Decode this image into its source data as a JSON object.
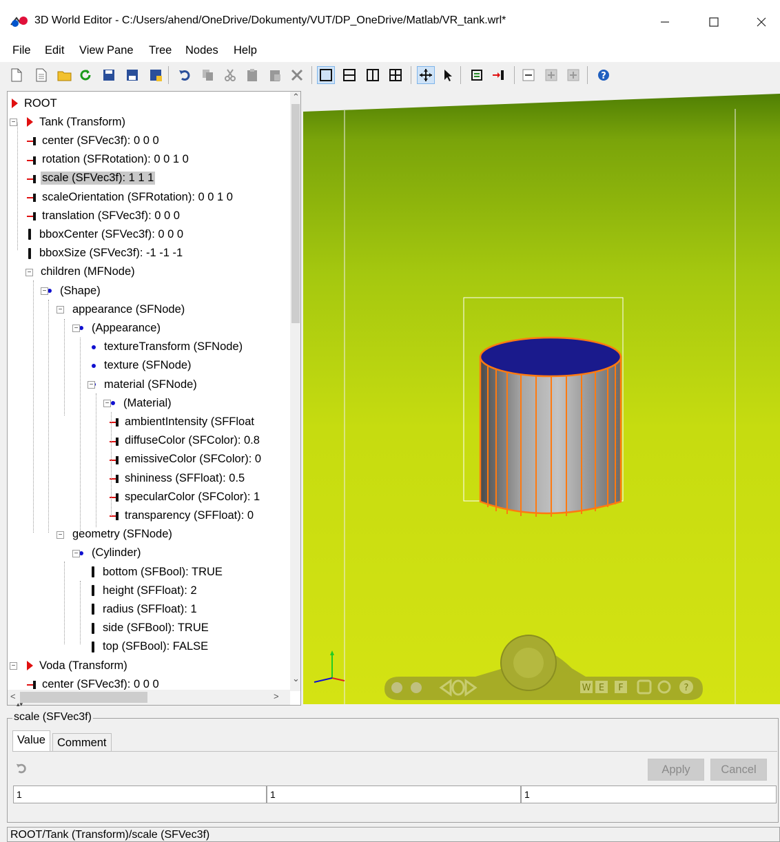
{
  "window": {
    "title": "3D World Editor - C:/Users/ahend/OneDrive/Dokumenty/VUT/DP_OneDrive/Matlab/VR_tank.wrl*"
  },
  "menu": [
    "File",
    "Edit",
    "View Pane",
    "Tree",
    "Nodes",
    "Help"
  ],
  "toolbar": {
    "icons": [
      "new-document-icon",
      "new-from-template-icon",
      "open-folder-icon",
      "reload-icon",
      "save-icon",
      "save-as-icon",
      "save-copy-icon",
      "undo-icon",
      "copy-icon",
      "cut-icon",
      "paste-icon",
      "paste-special-icon",
      "delete-icon",
      "single-view-icon",
      "split-horizontal-icon",
      "split-vertical-icon",
      "quad-view-icon",
      "move-icon",
      "select-arrow-icon",
      "inline-node-icon",
      "insert-field-icon",
      "collapse-icon",
      "expand-icon",
      "expand-all-icon",
      "help-icon"
    ]
  },
  "tree": [
    {
      "label": "ROOT",
      "icon": "tri"
    },
    {
      "label": "Tank (Transform)",
      "icon": "tri"
    },
    {
      "label": "center (SFVec3f): 0  0  0",
      "icon": "field"
    },
    {
      "label": "rotation (SFRotation): 0  0  1  0",
      "icon": "field"
    },
    {
      "label": "scale (SFVec3f): 1  1  1",
      "icon": "field"
    },
    {
      "label": "scaleOrientation (SFRotation): 0  0  1  0",
      "icon": "field"
    },
    {
      "label": "translation (SFVec3f): 0  0  0",
      "icon": "field"
    },
    {
      "label": "bboxCenter (SFVec3f): 0  0  0",
      "icon": "bar"
    },
    {
      "label": "bboxSize (SFVec3f): -1 -1 -1",
      "icon": "bar"
    },
    {
      "label": "children (MFNode)",
      "icon": "dot"
    },
    {
      "label": "(Shape)",
      "icon": "dot"
    },
    {
      "label": "appearance (SFNode)",
      "icon": "dot"
    },
    {
      "label": "(Appearance)",
      "icon": "dot"
    },
    {
      "label": "textureTransform (SFNode)",
      "icon": "dot"
    },
    {
      "label": "texture (SFNode)",
      "icon": "dot"
    },
    {
      "label": "material (SFNode)",
      "icon": "dot"
    },
    {
      "label": "(Material)",
      "icon": "dot"
    },
    {
      "label": "ambientIntensity (SFFloat",
      "icon": "field"
    },
    {
      "label": "diffuseColor (SFColor): 0.8",
      "icon": "field"
    },
    {
      "label": "emissiveColor (SFColor): 0",
      "icon": "field"
    },
    {
      "label": "shininess (SFFloat): 0.5",
      "icon": "field"
    },
    {
      "label": "specularColor (SFColor): 1",
      "icon": "field"
    },
    {
      "label": "transparency (SFFloat): 0",
      "icon": "field"
    },
    {
      "label": "geometry (SFNode)",
      "icon": "dot"
    },
    {
      "label": "(Cylinder)",
      "icon": "dot"
    },
    {
      "label": "bottom (SFBool): TRUE",
      "icon": "bar"
    },
    {
      "label": "height (SFFloat): 2",
      "icon": "bar"
    },
    {
      "label": "radius (SFFloat): 1",
      "icon": "bar"
    },
    {
      "label": "side (SFBool): TRUE",
      "icon": "bar"
    },
    {
      "label": "top (SFBool): FALSE",
      "icon": "bar"
    },
    {
      "label": "Voda (Transform)",
      "icon": "tri"
    },
    {
      "label": "center (SFVec3f): 0  0  0",
      "icon": "field"
    }
  ],
  "view3d": {
    "nav_buttons": [
      "W",
      "E",
      "F",
      "?"
    ]
  },
  "props": {
    "group_title": "scale (SFVec3f)",
    "tabs": [
      "Value",
      "Comment"
    ],
    "apply_label": "Apply",
    "cancel_label": "Cancel",
    "values": [
      "1",
      "1",
      "1"
    ]
  },
  "status": "ROOT/Tank (Transform)/scale (SFVec3f)",
  "colors": {
    "cylinder_top": "#1a1a8c",
    "cylinder_outline": "#ff7a10",
    "background_top": "#4d7d04",
    "background_bottom": "#d4e313"
  }
}
